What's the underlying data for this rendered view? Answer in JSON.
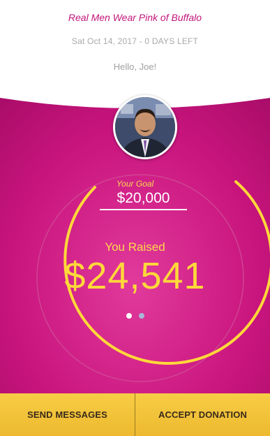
{
  "event": {
    "title": "Real Men Wear Pink of Buffalo",
    "date_status": "Sat Oct 14, 2017 - 0 DAYS LEFT",
    "greeting": "Hello, Joe!"
  },
  "profile": {
    "avatar_icon": "user-photo"
  },
  "goal": {
    "label": "Your Goal",
    "amount": "$20,000"
  },
  "raised": {
    "label": "You Raised",
    "amount": "$24,541",
    "progress_fraction": 1.0
  },
  "carousel": {
    "pages": 2,
    "active_index": 0
  },
  "actions": {
    "send_messages": "SEND MESSAGES",
    "accept_donation": "ACCEPT DONATION"
  },
  "colors": {
    "brand_magenta": "#c2167c",
    "accent_yellow": "#ffd83a",
    "button_yellow": "#f4c53e"
  }
}
